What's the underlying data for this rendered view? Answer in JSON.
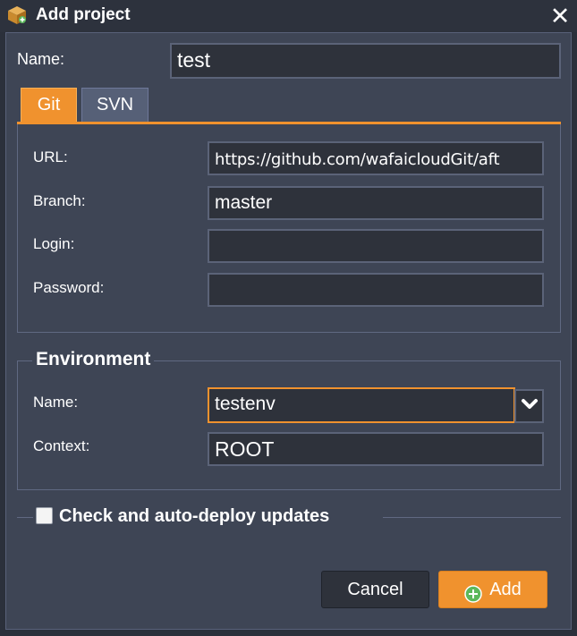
{
  "dialog": {
    "title": "Add project",
    "title_icon": "package-box-icon",
    "close_icon": "close-icon",
    "close_glyph": "✕"
  },
  "project": {
    "name_label": "Name:",
    "name_value": "test"
  },
  "tabs": [
    {
      "label": "Git",
      "active": true
    },
    {
      "label": "SVN",
      "active": false
    }
  ],
  "repo": {
    "url_label": "URL:",
    "url_value": "https://github.com/wafaicloudGit/aft",
    "branch_label": "Branch:",
    "branch_value": "master",
    "login_label": "Login:",
    "login_value": "",
    "password_label": "Password:",
    "password_value": ""
  },
  "environment": {
    "legend": "Environment",
    "name_label": "Name:",
    "name_value": "testenv",
    "dropdown_icon": "chevron-down-icon",
    "context_label": "Context:",
    "context_value": "ROOT"
  },
  "autodeploy": {
    "label": "Check and auto-deploy updates",
    "checked": false
  },
  "buttons": {
    "cancel": "Cancel",
    "add": "Add",
    "add_icon": "plus-circle-icon"
  },
  "colors": {
    "accent": "#f0922e",
    "panel": "#3e4555",
    "input_bg": "#2e323b",
    "tab_inactive": "#566077"
  }
}
